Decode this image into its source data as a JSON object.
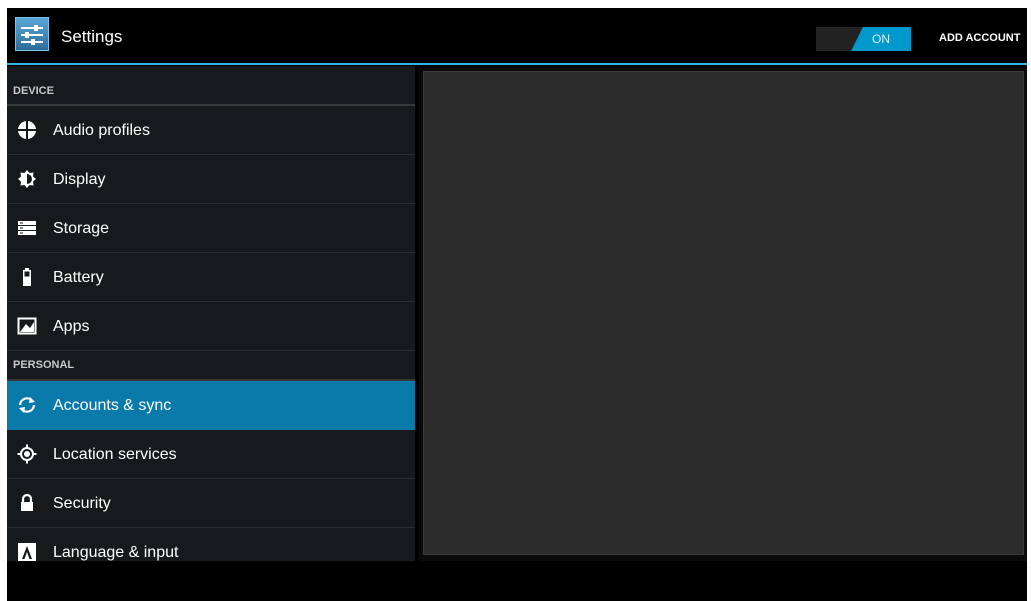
{
  "actionbar": {
    "title": "Settings",
    "app_icon": "settings-sliders-icon",
    "toggle_label": "ON",
    "toggle_state": "on",
    "add_account_label": "ADD ACCOUNT"
  },
  "colors": {
    "accent": "#33b5e5",
    "selected": "#0a7aab",
    "background": "#171a1c"
  },
  "sidebar": {
    "device_header": "DEVICE",
    "device_items": [
      {
        "label": "Audio profiles",
        "icon": "audio-profiles-icon"
      },
      {
        "label": "Display",
        "icon": "display-brightness-icon"
      },
      {
        "label": "Storage",
        "icon": "storage-icon"
      },
      {
        "label": "Battery",
        "icon": "battery-icon"
      },
      {
        "label": "Apps",
        "icon": "apps-icon"
      }
    ],
    "personal_header": "PERSONAL",
    "personal_items": [
      {
        "label": "Accounts & sync",
        "icon": "sync-icon",
        "selected": true
      },
      {
        "label": "Location services",
        "icon": "location-icon"
      },
      {
        "label": "Security",
        "icon": "lock-icon"
      },
      {
        "label": "Language & input",
        "icon": "language-icon"
      }
    ]
  }
}
